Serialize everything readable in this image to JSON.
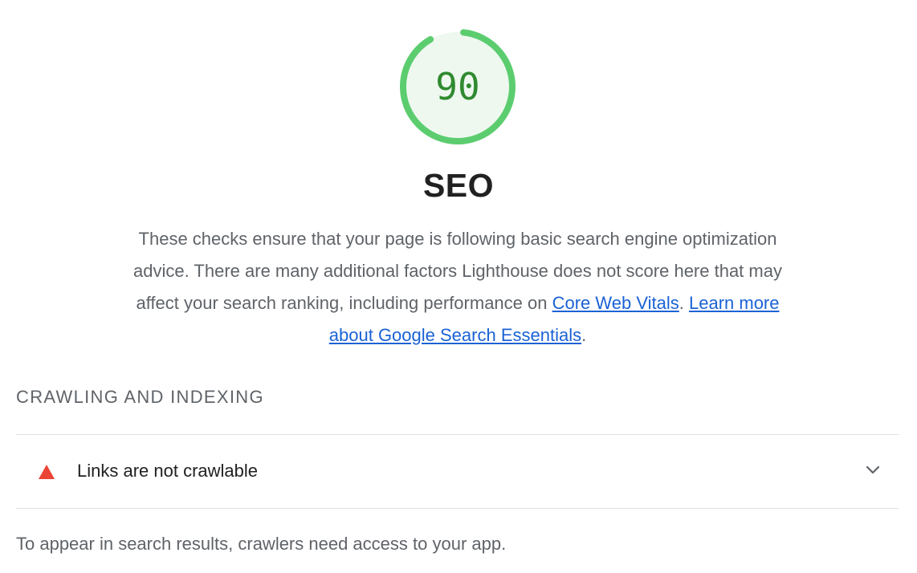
{
  "gauge": {
    "score": 90,
    "score_label": "90",
    "color": "#5ccd6f",
    "fill_color": "#eef8ef",
    "text_color": "#2f8a2f"
  },
  "category": {
    "title": "SEO",
    "description_part1": "These checks ensure that your page is following basic search engine optimization advice. There are many additional factors Lighthouse does not score here that may affect your search ranking, including performance on ",
    "link1": "Core Web Vitals",
    "description_part2": ". ",
    "link2": "Learn more about Google Search Essentials",
    "description_part3": "."
  },
  "group": {
    "title": "CRAWLING AND INDEXING"
  },
  "audits": [
    {
      "status": "fail",
      "status_icon": "warning-triangle-icon",
      "status_color": "#eb4335",
      "title": "Links are not crawlable",
      "expand_icon": "chevron-down-icon"
    }
  ],
  "group_help": "To appear in search results, crawlers need access to your app."
}
